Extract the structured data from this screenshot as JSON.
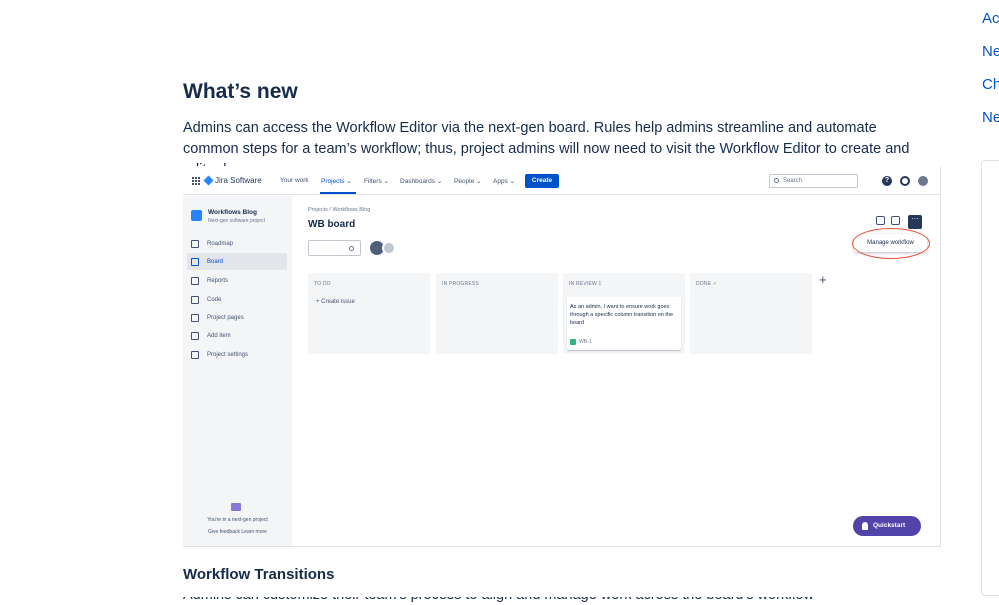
{
  "toc": [
    "Act",
    "Ne",
    "Ch",
    "Ne"
  ],
  "article": {
    "heading": "What’s new",
    "paragraph": "Admins can access the Workflow Editor via the next-gen board. Rules help admins streamline and automate common steps for a team’s workflow; thus, project admins will now need to visit the Workflow Editor to create and edit rules.",
    "subheading": "Workflow Transitions",
    "cutoff_text": "Admins can customize their team's process to align and manage work across the board's workflow transitions."
  },
  "jira": {
    "logo": "Jira Software",
    "nav": [
      "Your work",
      "Projects ⌄",
      "Filters ⌄",
      "Dashboards ⌄",
      "People ⌄",
      "Apps ⌄"
    ],
    "create": "Create",
    "search_placeholder": "Search",
    "help_glyph": "?",
    "project_name": "Workflows Blog",
    "project_sub": "Next-gen software project",
    "sidebar": [
      "Roadmap",
      "Board",
      "Reports",
      "Code",
      "Project pages",
      "Add item",
      "Project settings"
    ],
    "active_sidebar": "Board",
    "footer_line1": "You're in a next-gen project",
    "footer_line2": "Give feedback   Learn more",
    "breadcrumb": "Projects  /  Workflows Blog",
    "board_title": "WB board",
    "columns": [
      {
        "title": "TO DO"
      },
      {
        "title": "IN PROGRESS"
      },
      {
        "title": "IN REVIEW  1"
      },
      {
        "title": "DONE  ✓"
      }
    ],
    "create_issue": "+  Create issue",
    "card_text": "As an admin, I want to ensure work goes through a specific column transition on the board",
    "card_key": "WB-1",
    "add_column": "+",
    "more_glyph": "···",
    "manage_workflow": "Manage workflow",
    "quickstart": "Quickstart"
  },
  "colors": {
    "link": "#0052cc",
    "primary": "#0052cc",
    "quickstart": "#5243aa",
    "highlight_ring": "#e5533d"
  }
}
